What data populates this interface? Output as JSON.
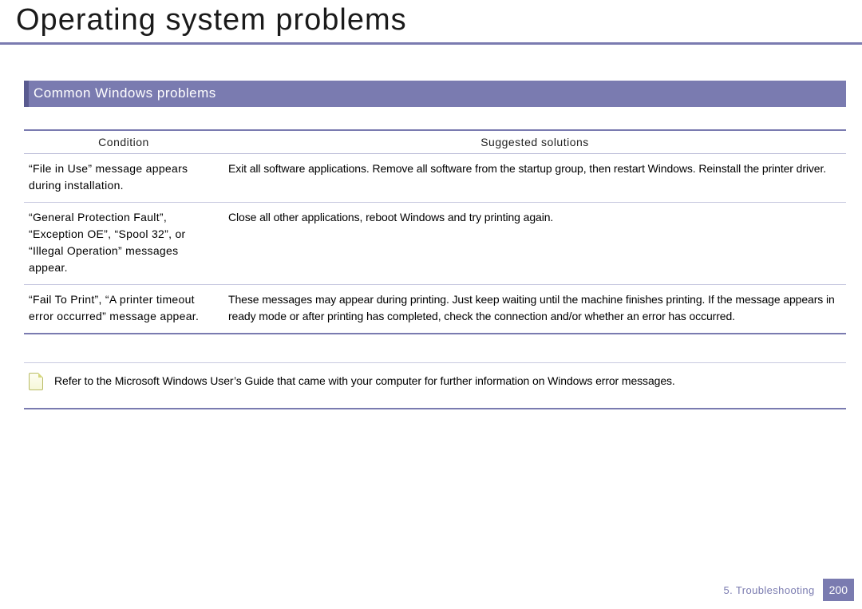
{
  "title": "Operating system problems",
  "section": "Common Windows problems",
  "headers": {
    "condition": "Condition",
    "solutions": "Suggested solutions"
  },
  "rows": [
    {
      "condition": "“File in Use” message appears during installation.",
      "solution": "Exit all software applications. Remove all software from the startup group, then restart Windows. Reinstall the printer driver."
    },
    {
      "condition": "“General Protection Fault”, “Exception OE”, “Spool 32”, or “Illegal Operation” messages appear.",
      "solution": "Close all other applications, reboot Windows and try printing again."
    },
    {
      "condition": "“Fail To Print”, “A printer timeout error occurred” message appear.",
      "solution": "These messages may appear during printing. Just keep waiting until the machine finishes printing. If the message appears in ready mode or after printing has completed, check the connection and/or whether an error has occurred."
    }
  ],
  "note": "Refer to the Microsoft Windows User’s Guide that came with your computer for further information on Windows error messages.",
  "footer": {
    "chapter": "5.  Troubleshooting",
    "page": "200"
  }
}
